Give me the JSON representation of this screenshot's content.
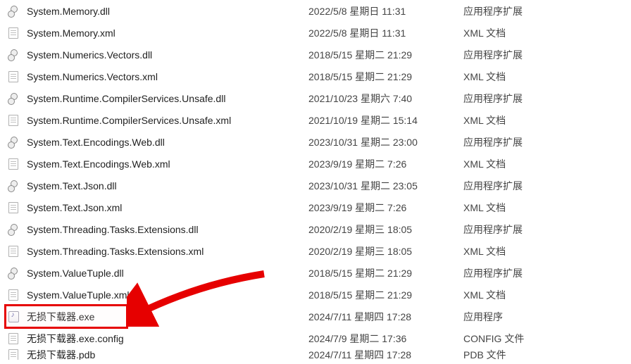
{
  "files": [
    {
      "name": "System.Memory.dll",
      "date": "2022/5/8 星期日 11:31",
      "type": "应用程序扩展",
      "icon": "dll"
    },
    {
      "name": "System.Memory.xml",
      "date": "2022/5/8 星期日 11:31",
      "type": "XML 文档",
      "icon": "doc"
    },
    {
      "name": "System.Numerics.Vectors.dll",
      "date": "2018/5/15 星期二 21:29",
      "type": "应用程序扩展",
      "icon": "dll"
    },
    {
      "name": "System.Numerics.Vectors.xml",
      "date": "2018/5/15 星期二 21:29",
      "type": "XML 文档",
      "icon": "doc"
    },
    {
      "name": "System.Runtime.CompilerServices.Unsafe.dll",
      "date": "2021/10/23 星期六 7:40",
      "type": "应用程序扩展",
      "icon": "dll"
    },
    {
      "name": "System.Runtime.CompilerServices.Unsafe.xml",
      "date": "2021/10/19 星期二 15:14",
      "type": "XML 文档",
      "icon": "doc"
    },
    {
      "name": "System.Text.Encodings.Web.dll",
      "date": "2023/10/31 星期二 23:00",
      "type": "应用程序扩展",
      "icon": "dll"
    },
    {
      "name": "System.Text.Encodings.Web.xml",
      "date": "2023/9/19 星期二 7:26",
      "type": "XML 文档",
      "icon": "doc"
    },
    {
      "name": "System.Text.Json.dll",
      "date": "2023/10/31 星期二 23:05",
      "type": "应用程序扩展",
      "icon": "dll"
    },
    {
      "name": "System.Text.Json.xml",
      "date": "2023/9/19 星期二 7:26",
      "type": "XML 文档",
      "icon": "doc"
    },
    {
      "name": "System.Threading.Tasks.Extensions.dll",
      "date": "2020/2/19 星期三 18:05",
      "type": "应用程序扩展",
      "icon": "dll"
    },
    {
      "name": "System.Threading.Tasks.Extensions.xml",
      "date": "2020/2/19 星期三 18:05",
      "type": "XML 文档",
      "icon": "doc"
    },
    {
      "name": "System.ValueTuple.dll",
      "date": "2018/5/15 星期二 21:29",
      "type": "应用程序扩展",
      "icon": "dll"
    },
    {
      "name": "System.ValueTuple.xml",
      "date": "2018/5/15 星期二 21:29",
      "type": "XML 文档",
      "icon": "doc"
    },
    {
      "name": "无损下载器.exe",
      "date": "2024/7/11 星期四 17:28",
      "type": "应用程序",
      "icon": "exe",
      "highlighted": true
    },
    {
      "name": "无损下载器.exe.config",
      "date": "2024/7/9 星期二 17:36",
      "type": "CONFIG 文件",
      "icon": "doc"
    },
    {
      "name": "无损下载器.pdb",
      "date": "2024/7/11 星期四 17:28",
      "type": "PDB 文件",
      "icon": "doc"
    }
  ]
}
